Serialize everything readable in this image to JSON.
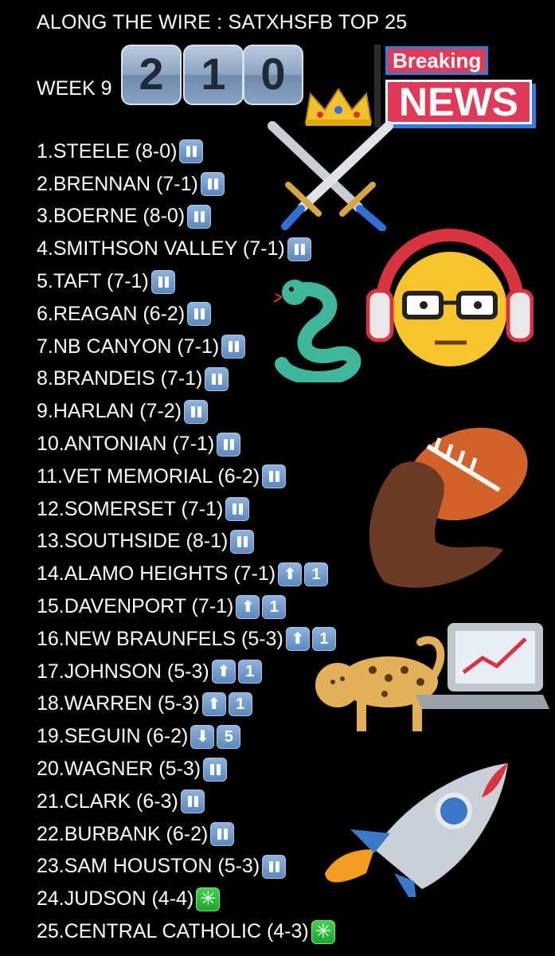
{
  "title": "ALONG THE WIRE : SATXHSFB TOP 25",
  "week_label": "WEEK 9",
  "countdown_digits": [
    "2",
    "1",
    "0"
  ],
  "breaking": {
    "top": "Breaking",
    "main": "NEWS"
  },
  "rankings": [
    {
      "text": "1.STEELE (8-0)",
      "badges": [
        {
          "type": "pause"
        }
      ]
    },
    {
      "text": "2.BRENNAN (7-1)",
      "badges": [
        {
          "type": "pause"
        }
      ]
    },
    {
      "text": "3.BOERNE (8-0)",
      "badges": [
        {
          "type": "pause"
        }
      ]
    },
    {
      "text": "4.SMITHSON VALLEY (7-1)",
      "badges": [
        {
          "type": "pause"
        }
      ]
    },
    {
      "text": "5.TAFT (7-1)",
      "badges": [
        {
          "type": "pause"
        }
      ]
    },
    {
      "text": "6.REAGAN (6-2)",
      "badges": [
        {
          "type": "pause"
        }
      ]
    },
    {
      "text": "7.NB CANYON (7-1)",
      "badges": [
        {
          "type": "pause"
        }
      ]
    },
    {
      "text": "8.BRANDEIS (7-1)",
      "badges": [
        {
          "type": "pause"
        }
      ]
    },
    {
      "text": "9.HARLAN (7-2)",
      "badges": [
        {
          "type": "pause"
        }
      ]
    },
    {
      "text": "10.ANTONIAN (7-1)",
      "badges": [
        {
          "type": "pause"
        }
      ]
    },
    {
      "text": "11.VET MEMORIAL (6-2)",
      "badges": [
        {
          "type": "pause"
        }
      ]
    },
    {
      "text": "12.SOMERSET (7-1)",
      "badges": [
        {
          "type": "pause"
        }
      ]
    },
    {
      "text": "13.SOUTHSIDE (8-1)",
      "badges": [
        {
          "type": "pause"
        }
      ]
    },
    {
      "text": "14.ALAMO HEIGHTS (7-1)",
      "badges": [
        {
          "type": "up"
        },
        {
          "type": "num",
          "value": "1"
        }
      ]
    },
    {
      "text": "15.DAVENPORT (7-1)",
      "badges": [
        {
          "type": "up"
        },
        {
          "type": "num",
          "value": "1"
        }
      ]
    },
    {
      "text": "16.NEW BRAUNFELS (5-3)",
      "badges": [
        {
          "type": "up"
        },
        {
          "type": "num",
          "value": "1"
        }
      ]
    },
    {
      "text": "17.JOHNSON (5-3)",
      "badges": [
        {
          "type": "up"
        },
        {
          "type": "num",
          "value": "1"
        }
      ]
    },
    {
      "text": "18.WARREN (5-3)",
      "badges": [
        {
          "type": "up"
        },
        {
          "type": "num",
          "value": "1"
        }
      ]
    },
    {
      "text": "19.SEGUIN (6-2)",
      "badges": [
        {
          "type": "down"
        },
        {
          "type": "num",
          "value": "5"
        }
      ]
    },
    {
      "text": "20.WAGNER (5-3)",
      "badges": [
        {
          "type": "pause"
        }
      ]
    },
    {
      "text": "21.CLARK (6-3)",
      "badges": [
        {
          "type": "pause"
        }
      ]
    },
    {
      "text": "22.BURBANK (6-2)",
      "badges": [
        {
          "type": "pause"
        }
      ]
    },
    {
      "text": "23.SAM HOUSTON (5-3)",
      "badges": [
        {
          "type": "pause"
        }
      ]
    },
    {
      "text": "24.JUDSON (4-4)",
      "badges": [
        {
          "type": "new"
        }
      ]
    },
    {
      "text": "25.CENTRAL CATHOLIC (4-3)",
      "badges": [
        {
          "type": "new"
        }
      ]
    }
  ],
  "icons": {
    "pause": "pause-icon",
    "up": "up-arrow-icon",
    "down": "down-arrow-icon",
    "new": "sparkle-icon"
  },
  "colors": {
    "background": "#000000",
    "text": "#ffffff",
    "badge_blue": "#5b88bd",
    "badge_green": "#1ea62d",
    "news_red": "#e13a59"
  }
}
